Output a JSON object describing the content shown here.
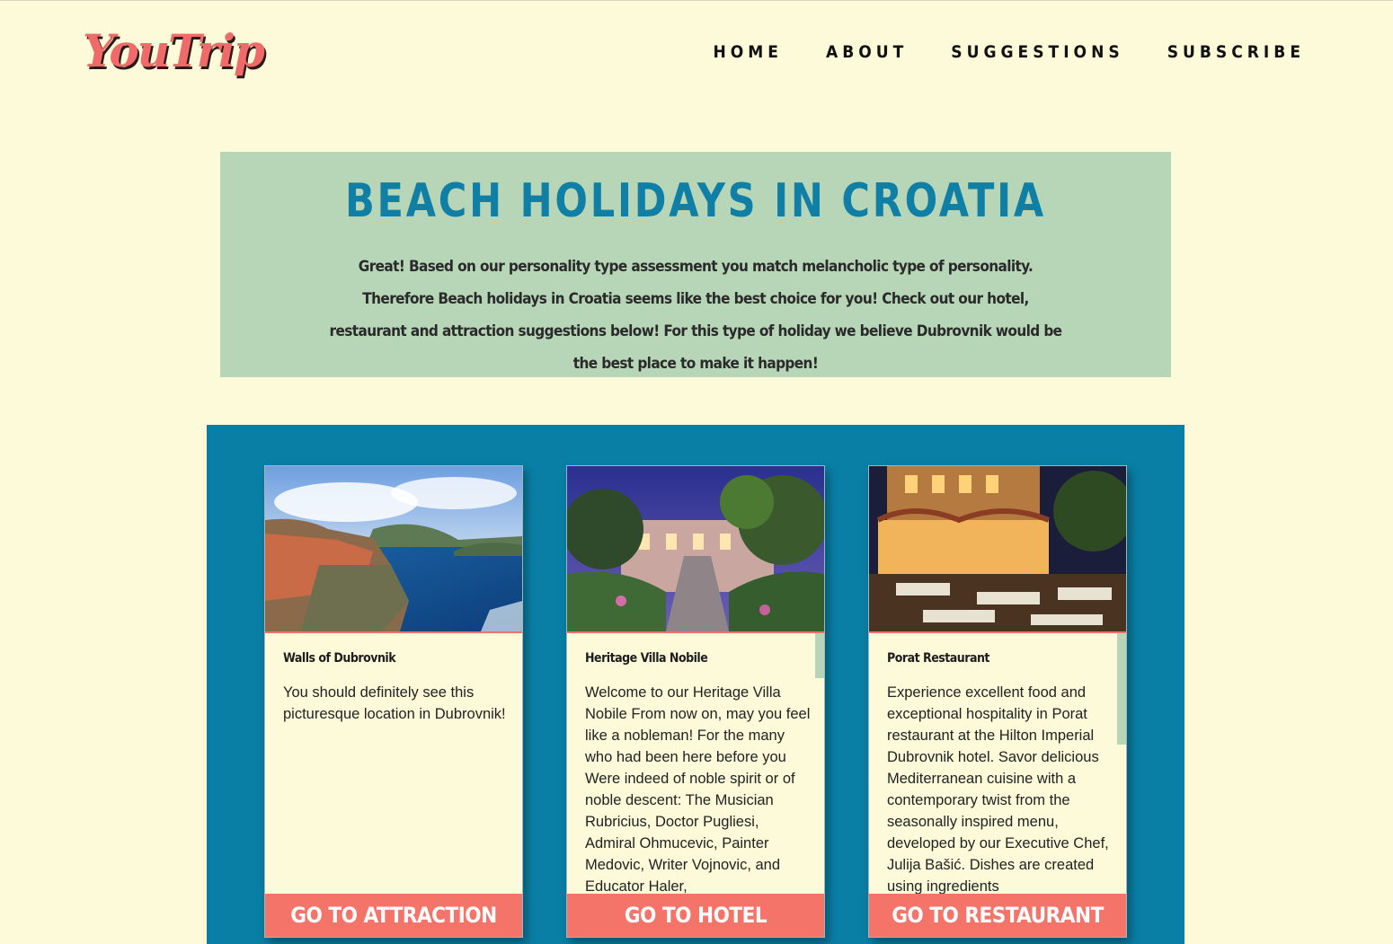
{
  "header": {
    "logo_text": "YouTrip",
    "nav": [
      {
        "label": "HOME"
      },
      {
        "label": "ABOUT"
      },
      {
        "label": "SUGGESTIONS"
      },
      {
        "label": "SUBSCRIBE"
      }
    ]
  },
  "hero": {
    "title": "BEACH HOLIDAYS IN CROATIA",
    "text": "Great! Based on our personality type assessment you match melancholic type of personality. Therefore Beach holidays in Croatia seems like the best choice for you! Check out our hotel, restaurant and attraction suggestions below! For this type of holiday we believe Dubrovnik would be the best place to make it happen!"
  },
  "cards": [
    {
      "title": "Walls of Dubrovnik",
      "description": "You should definitely see this picturesque location in Dubrovnik!",
      "button": "GO TO ATTRACTION",
      "image": "dubrovnik-walls-coast-photo"
    },
    {
      "title": "Heritage Villa Nobile",
      "description": "Welcome to our Heritage Villa Nobile From now on, may you feel like a nobleman! For the many who had been here before you Were indeed of noble spirit or of noble descent: The Musician Rubricius, Doctor Pugliesi, Admiral Ohmucevic, Painter Medovic, Writer Vojnovic, and Educator Haler,",
      "button": "GO TO HOTEL",
      "image": "villa-garden-photo"
    },
    {
      "title": "Porat Restaurant",
      "description": "Experience excellent food and exceptional hospitality in Porat restaurant at the Hilton Imperial Dubrovnik hotel. Savor delicious Mediterranean cuisine with a contemporary twist from the seasonally inspired menu, developed by our Executive Chef, Julija Bašić. Dishes are created using ingredients",
      "button": "GO TO RESTAURANT",
      "image": "restaurant-terrace-night-photo"
    }
  ],
  "colors": {
    "background": "#fcfad8",
    "hero_bg": "#b7d6b8",
    "title": "#0f7fa5",
    "section_bg": "#0a7fa6",
    "button": "#f47469",
    "logo": "#ef6a68"
  }
}
